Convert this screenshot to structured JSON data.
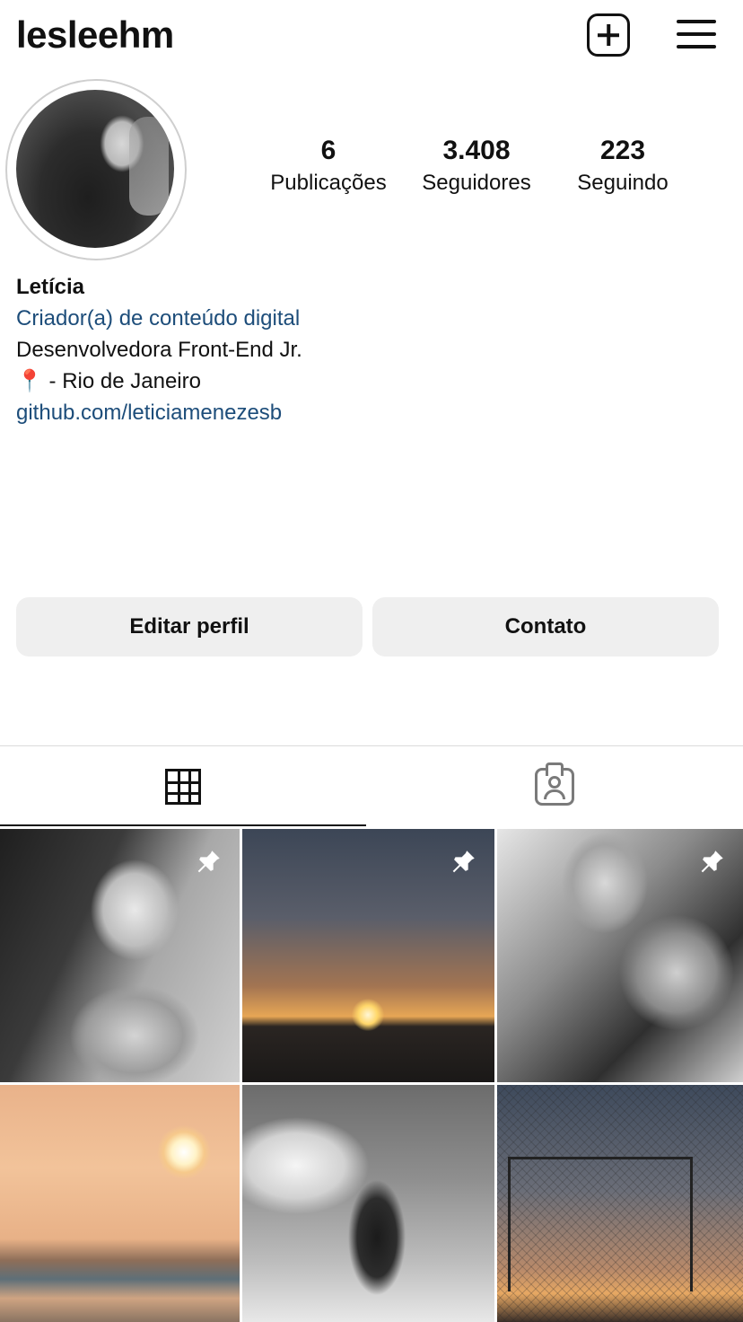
{
  "header": {
    "username": "lesleehm",
    "icons": [
      "plus-square-icon",
      "hamburger-menu-icon"
    ]
  },
  "profile": {
    "avatar_icon": "profile-photo",
    "stats": [
      {
        "value": "6",
        "label": "Publicações"
      },
      {
        "value": "3.408",
        "label": "Seguidores"
      },
      {
        "value": "223",
        "label": "Seguindo"
      }
    ],
    "bio": {
      "name": "Letícia",
      "category": "Criador(a) de conteúdo digital",
      "line1": "Desenvolvedora Front-End Jr.",
      "location_emoji": "📍",
      "line2": " - Rio de Janeiro",
      "link": "github.com/leticiamenezesb"
    }
  },
  "actions": {
    "edit_label": "Editar perfil",
    "contact_label": "Contato"
  },
  "tabs": [
    {
      "name": "grid",
      "icon": "grid-icon",
      "selected": true
    },
    {
      "name": "tagged",
      "icon": "tagged-user-icon",
      "selected": false
    }
  ],
  "posts": [
    {
      "pinned": true
    },
    {
      "pinned": true
    },
    {
      "pinned": true
    },
    {
      "pinned": false
    },
    {
      "pinned": false
    },
    {
      "pinned": false
    }
  ],
  "colors": {
    "link": "#1d4d7a",
    "button_bg": "#efefef",
    "divider": "#dbdbdb"
  }
}
